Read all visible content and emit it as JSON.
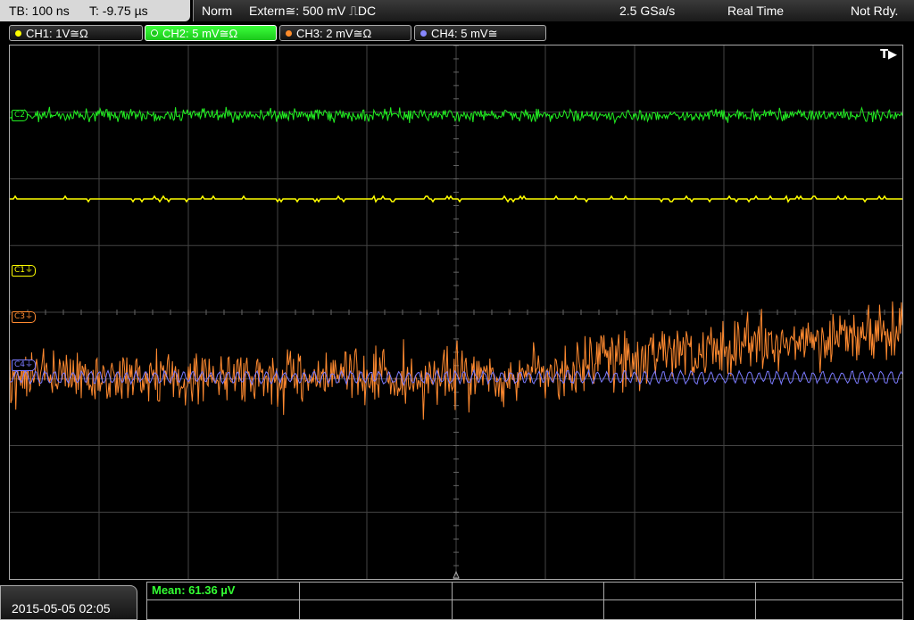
{
  "status": {
    "timebase": "TB: 100 ns",
    "trigger_offset": "T: -9.75 µs",
    "mode": "Norm",
    "trigger_source": "Extern≅: 500 mV ⎍DC",
    "sample_rate": "2.5 GSa/s",
    "acquisition": "Real Time",
    "state": "Not Rdy."
  },
  "channels": [
    {
      "label": "CH1: 1V≅Ω",
      "color": "#ffff00",
      "active": false
    },
    {
      "label": "CH2: 5 mV≅Ω",
      "color": "#33ff33",
      "active": true
    },
    {
      "label": "CH3: 2 mV≅Ω",
      "color": "#ff8c2a",
      "active": false
    },
    {
      "label": "CH4: 5 mV≅",
      "color": "#8888ff",
      "active": false
    }
  ],
  "markers": {
    "ch2": "C2",
    "ch1": "C1⏚",
    "ch3": "C3⏚",
    "ch4": "C4⏚",
    "trigger_position": "T▶"
  },
  "measurement": {
    "mean": "Mean: 61.36 µV"
  },
  "datetime": "2015-05-05 02:05",
  "colors": {
    "ch1": "#ffff00",
    "ch2": "#22ee22",
    "ch3": "#ff8a30",
    "ch4": "#7b7bff",
    "grid": "#555555"
  }
}
